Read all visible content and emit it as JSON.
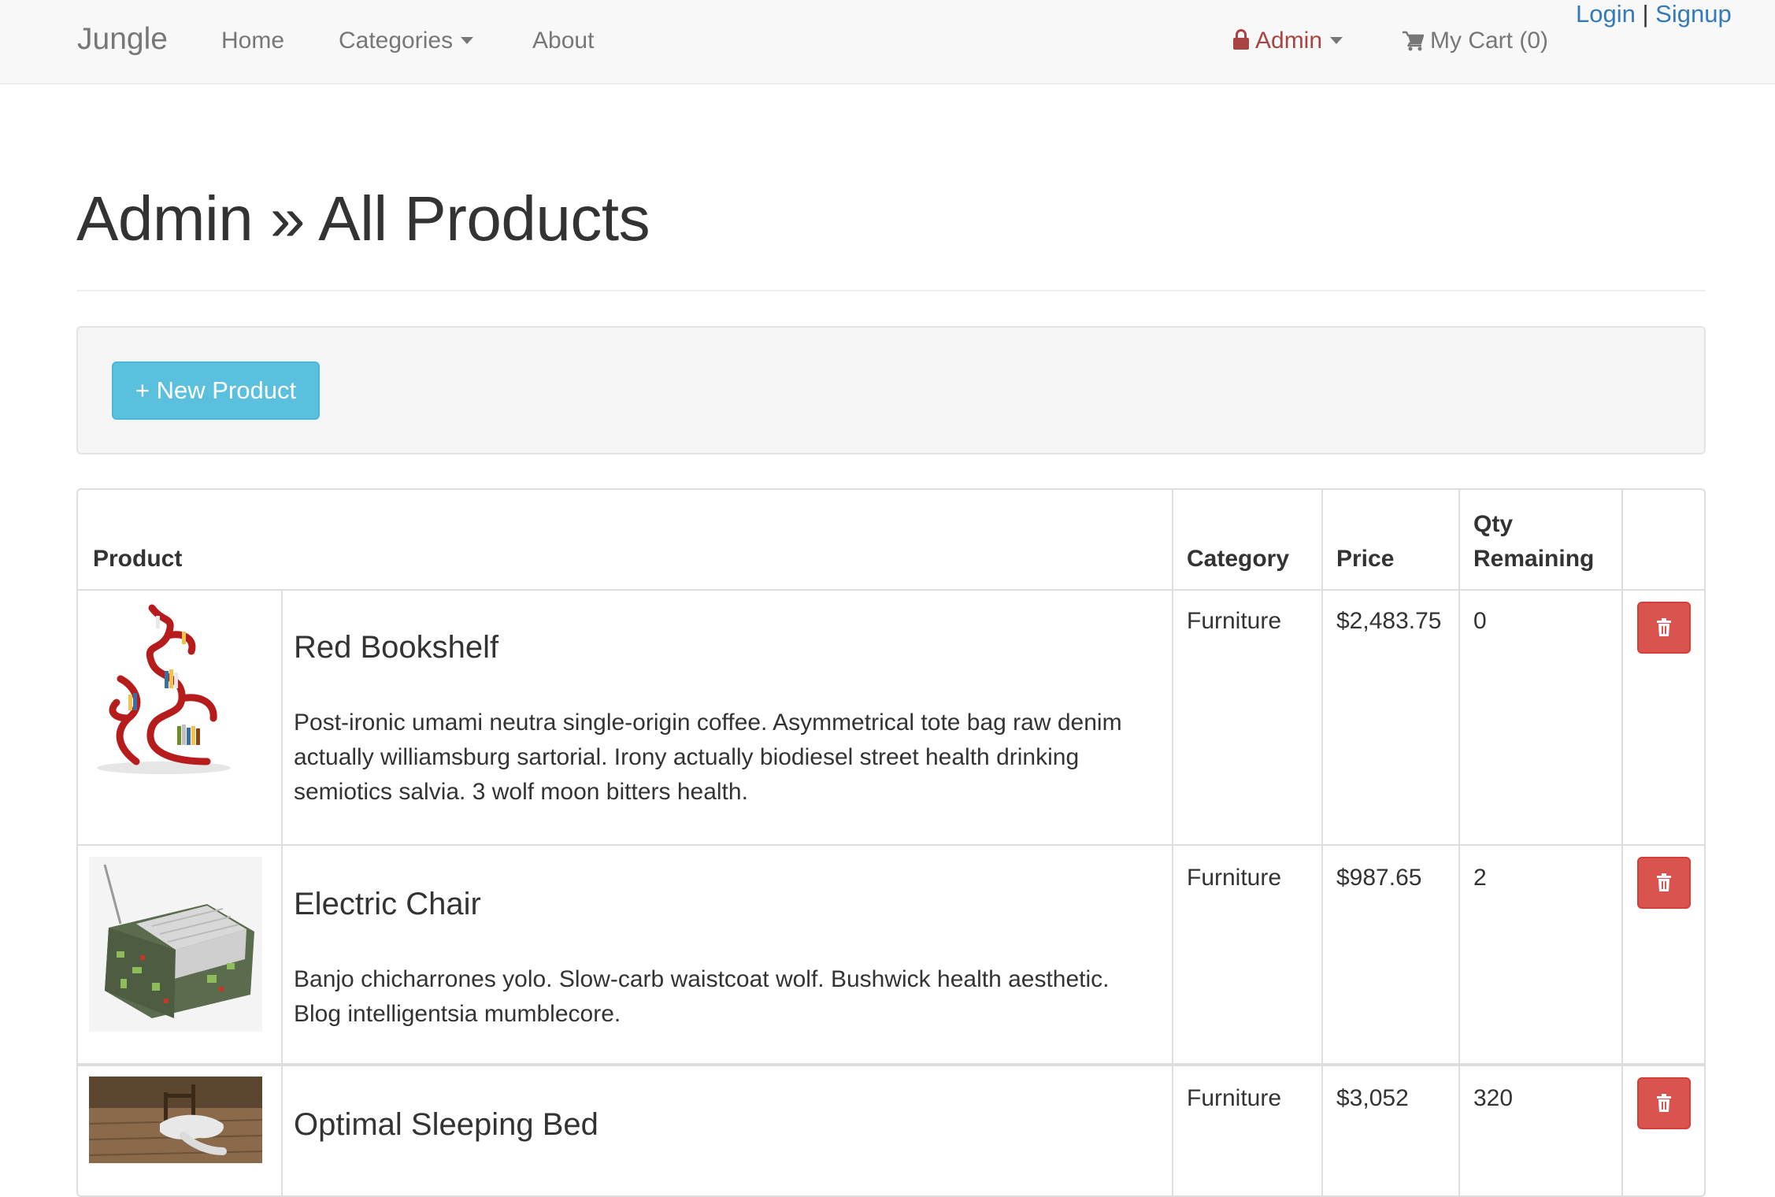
{
  "navbar": {
    "brand": "Jungle",
    "links": {
      "home": "Home",
      "categories": "Categories",
      "about": "About",
      "admin": "Admin",
      "cart": "My Cart (0)"
    },
    "auth": {
      "login": "Login",
      "separator": "|",
      "signup": "Signup"
    }
  },
  "page": {
    "title": "Admin » All Products"
  },
  "toolbar": {
    "new_product_label": "+ New Product"
  },
  "table": {
    "headers": {
      "product": "Product",
      "category": "Category",
      "price": "Price",
      "qty_line1": "Qty",
      "qty_line2": "Remaining"
    },
    "rows": [
      {
        "name": "Red Bookshelf",
        "description": "Post-ironic umami neutra single-origin coffee. Asymmetrical tote bag raw denim actually williamsburg sartorial. Irony actually biodiesel street health drinking semiotics salvia. 3 wolf moon bitters health.",
        "category": "Furniture",
        "price": "$2,483.75",
        "qty": "0",
        "image": "red-bookshelf"
      },
      {
        "name": "Electric Chair",
        "description": "Banjo chicharrones yolo. Slow-carb waistcoat wolf. Bushwick health aesthetic. Blog intelligentsia mumblecore.",
        "category": "Furniture",
        "price": "$987.65",
        "qty": "2",
        "image": "electric-chair"
      },
      {
        "name": "Optimal Sleeping Bed",
        "description": "",
        "category": "Furniture",
        "price": "$3,052",
        "qty": "320",
        "image": "sleeping-bed"
      }
    ]
  },
  "colors": {
    "navbar_bg": "#f8f8f8",
    "admin_link": "#a94442",
    "auth_link": "#337ab7",
    "info_button": "#5bc0de",
    "danger_button": "#d9534f"
  },
  "icons": {
    "admin": "lock-icon",
    "cart": "shopping-cart-icon",
    "delete": "trash-icon"
  }
}
